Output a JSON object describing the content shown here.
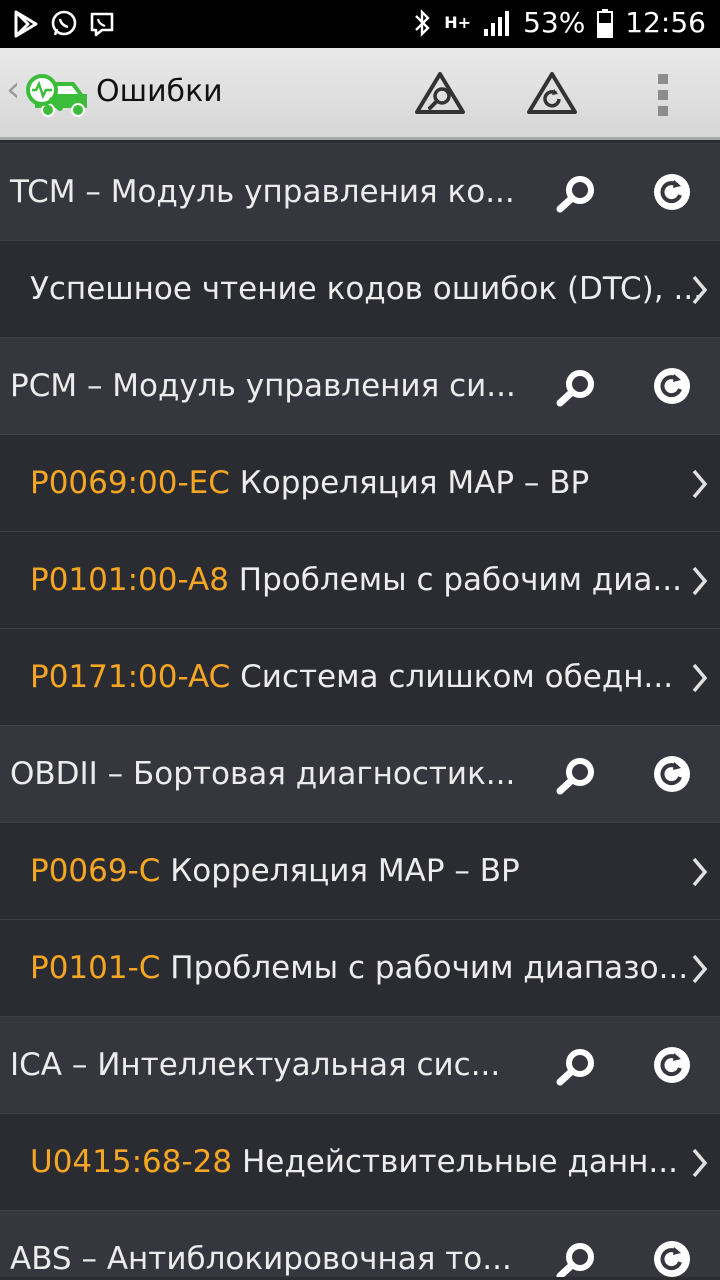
{
  "status_bar": {
    "battery": "53%",
    "network": "H+",
    "time": "12:56",
    "icons": [
      "play-store-icon",
      "whatsapp-icon",
      "viber-icon",
      "bluetooth-icon",
      "signal-icon",
      "battery-icon"
    ]
  },
  "toolbar": {
    "title": "Ошибки",
    "icons": [
      "app-logo-icon",
      "scan-errors-icon",
      "clear-errors-icon",
      "overflow-menu-icon"
    ]
  },
  "colors": {
    "code": "#f5a623",
    "group_bg": "#36363e",
    "item_bg": "#2b2b32",
    "accent_green": "#3bbd3b"
  },
  "rows": [
    {
      "type": "group",
      "text": "TCM – Модуль управления ко..."
    },
    {
      "type": "item",
      "code": "",
      "text": "Успешное чтение кодов ошибок (DTC), ..."
    },
    {
      "type": "group",
      "text": "PCM – Модуль управления си..."
    },
    {
      "type": "item",
      "code": "P0069:00-EC",
      "text": " Корреляция MAP – BP"
    },
    {
      "type": "item",
      "code": "P0101:00-A8",
      "text": " Проблемы с рабочим диа..."
    },
    {
      "type": "item",
      "code": "P0171:00-AC",
      "text": " Система слишком обедн..."
    },
    {
      "type": "group",
      "text": "OBDII – Бортовая диагностик..."
    },
    {
      "type": "item",
      "code": "P0069-C",
      "text": " Корреляция MAP – BP"
    },
    {
      "type": "item",
      "code": "P0101-C",
      "text": " Проблемы с рабочим диапазо..."
    },
    {
      "type": "group",
      "text": "ICA – Интеллектуальная сис..."
    },
    {
      "type": "item",
      "code": "U0415:68-28",
      "text": " Недействительные данн..."
    },
    {
      "type": "group",
      "text": "ABS – Антиблокировочная то..."
    }
  ]
}
